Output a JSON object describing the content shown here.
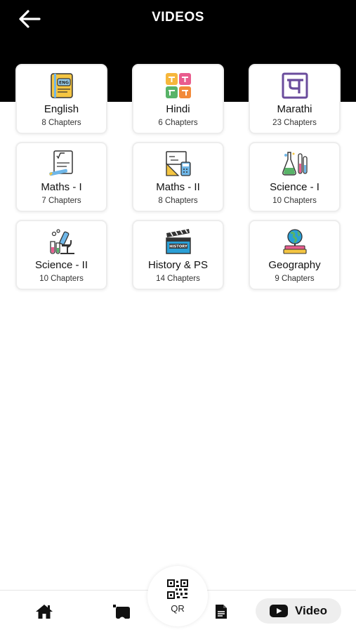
{
  "header": {
    "title": "VIDEOS",
    "back_icon": "arrow-left-icon"
  },
  "subjects": [
    {
      "name": "English",
      "chapters": "8 Chapters",
      "icon": "english-book-icon"
    },
    {
      "name": "Hindi",
      "chapters": "6 Chapters",
      "icon": "hindi-letters-icon"
    },
    {
      "name": "Marathi",
      "chapters": "23 Chapters",
      "icon": "marathi-letter-icon"
    },
    {
      "name": "Maths - I",
      "chapters": "7 Chapters",
      "icon": "math-formula-icon"
    },
    {
      "name": "Maths - II",
      "chapters": "8 Chapters",
      "icon": "geometry-board-icon"
    },
    {
      "name": "Science - I",
      "chapters": "10 Chapters",
      "icon": "lab-flasks-icon"
    },
    {
      "name": "Science - II",
      "chapters": "10 Chapters",
      "icon": "microscope-icon"
    },
    {
      "name": "History & PS",
      "chapters": "14 Chapters",
      "icon": "history-clapperboard-icon"
    },
    {
      "name": "Geography",
      "chapters": "9 Chapters",
      "icon": "globe-books-icon"
    }
  ],
  "bottom_nav": {
    "items": [
      {
        "icon": "home-icon"
      },
      {
        "icon": "books-icon"
      },
      {
        "icon": "document-icon"
      }
    ],
    "qr": {
      "label": "QR",
      "icon": "qr-code-icon"
    },
    "video": {
      "label": "Video",
      "icon": "youtube-play-icon"
    }
  },
  "colors": {
    "header_bg": "#000000",
    "active_pill": "#eeeeee"
  }
}
